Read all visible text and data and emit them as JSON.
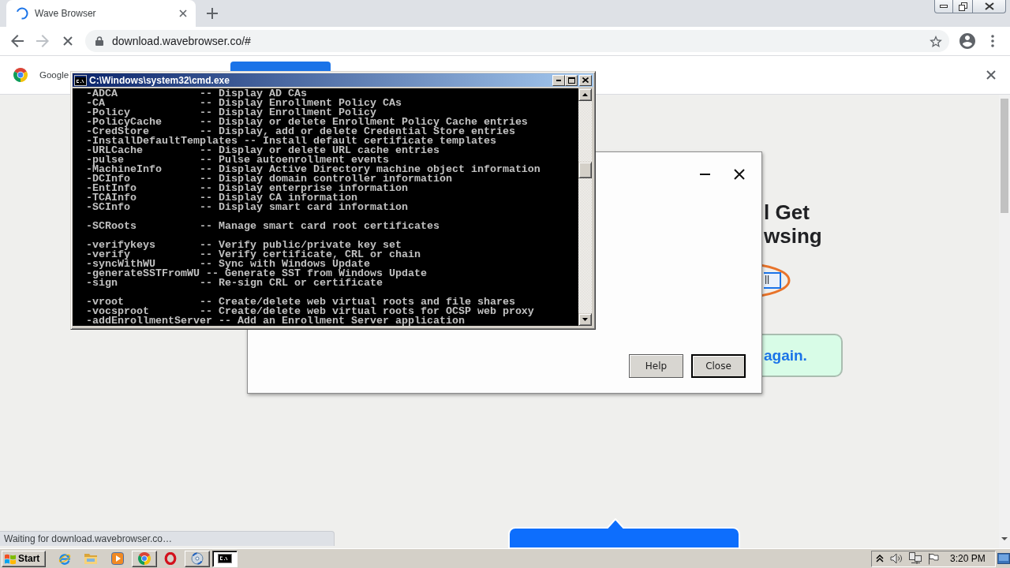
{
  "tabs": [
    {
      "title": "Wave Browser",
      "selected": true
    }
  ],
  "address_bar": {
    "url": "download.wavebrowser.co/#"
  },
  "infobar": {
    "text": "Google"
  },
  "page": {
    "heading_lines": [
      "l Get",
      "wsing"
    ],
    "button_text": "ll",
    "notice": "again."
  },
  "status_bar": "Waiting for download.wavebrowser.co…",
  "dialog": {
    "buttons": [
      {
        "label": "Help",
        "default": false
      },
      {
        "label": "Close",
        "default": true
      }
    ]
  },
  "console": {
    "title": "C:\\Windows\\system32\\cmd.exe",
    "blocks": [
      [
        "-ADCA             -- Display AD CAs",
        "-CA               -- Display Enrollment Policy CAs",
        "-Policy           -- Display Enrollment Policy",
        "-PolicyCache      -- Display or delete Enrollment Policy Cache entries",
        "-CredStore        -- Display, add or delete Credential Store entries",
        "-InstallDefaultTemplates -- Install default certificate templates",
        "-URLCache         -- Display or delete URL cache entries",
        "-pulse            -- Pulse autoenrollment events",
        "-MachineInfo      -- Display Active Directory machine object information",
        "-DCInfo           -- Display domain controller information",
        "-EntInfo          -- Display enterprise information",
        "-TCAInfo          -- Display CA information",
        "-SCInfo           -- Display smart card information"
      ],
      [
        "-SCRoots          -- Manage smart card root certificates"
      ],
      [
        "-verifykeys       -- Verify public/private key set",
        "-verify           -- Verify certificate, CRL or chain",
        "-syncWithWU       -- Sync with Windows Update",
        "-generateSSTFromWU -- Generate SST from Windows Update",
        "-sign             -- Re-sign CRL or certificate"
      ],
      [
        "-vroot            -- Create/delete web virtual roots and file shares",
        "-vocsproot        -- Create/delete web virtual roots for OCSP web proxy",
        "-addEnrollmentServer -- Add an Enrollment Server application"
      ]
    ]
  },
  "taskbar": {
    "start": "Start",
    "window_buttons": [
      {
        "selected": false
      },
      {
        "selected": false
      },
      {
        "selected": true
      }
    ],
    "clock": "3:20 PM"
  }
}
